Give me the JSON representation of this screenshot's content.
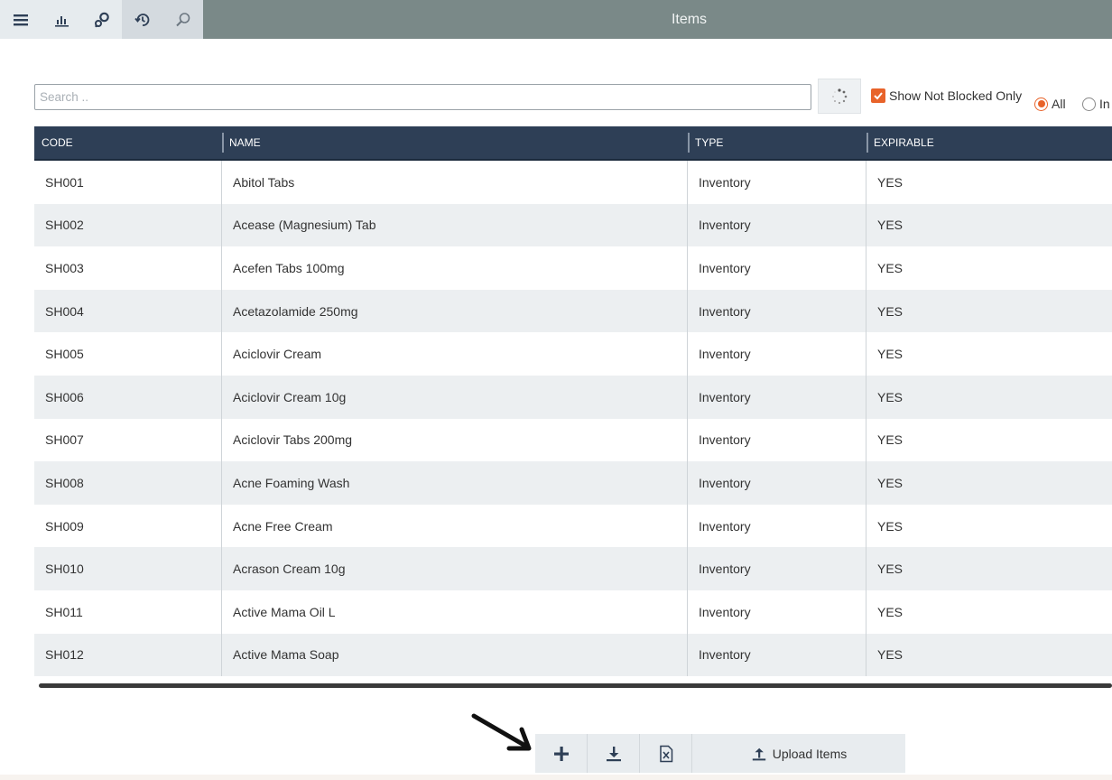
{
  "window": {
    "title": "Items"
  },
  "toolbar": {
    "buttons": [
      {
        "icon": "menu-icon"
      },
      {
        "icon": "chart-icon"
      },
      {
        "icon": "settings-icon"
      },
      {
        "icon": "history-icon"
      },
      {
        "icon": "search-icon"
      }
    ]
  },
  "filters": {
    "search_placeholder": "Search ..",
    "search_value": "",
    "show_not_blocked_label": "Show Not Blocked Only",
    "show_not_blocked_checked": true,
    "radio_all_label": "All",
    "radio_in_label": "In",
    "radio_selected": "All"
  },
  "table": {
    "columns": [
      "CODE",
      "NAME",
      "TYPE",
      "EXPIRABLE"
    ],
    "rows": [
      {
        "code": "SH001",
        "name": "Abitol Tabs",
        "type": "Inventory",
        "expirable": "YES"
      },
      {
        "code": "SH002",
        "name": "Acease (Magnesium) Tab",
        "type": "Inventory",
        "expirable": "YES"
      },
      {
        "code": "SH003",
        "name": "Acefen Tabs 100mg",
        "type": "Inventory",
        "expirable": "YES"
      },
      {
        "code": "SH004",
        "name": "Acetazolamide 250mg",
        "type": "Inventory",
        "expirable": "YES"
      },
      {
        "code": "SH005",
        "name": "Aciclovir Cream",
        "type": "Inventory",
        "expirable": "YES"
      },
      {
        "code": "SH006",
        "name": "Aciclovir Cream 10g",
        "type": "Inventory",
        "expirable": "YES"
      },
      {
        "code": "SH007",
        "name": "Aciclovir Tabs 200mg",
        "type": "Inventory",
        "expirable": "YES"
      },
      {
        "code": "SH008",
        "name": "Acne Foaming Wash",
        "type": "Inventory",
        "expirable": "YES"
      },
      {
        "code": "SH009",
        "name": "Acne Free Cream",
        "type": "Inventory",
        "expirable": "YES"
      },
      {
        "code": "SH010",
        "name": "Acrason Cream 10g",
        "type": "Inventory",
        "expirable": "YES"
      },
      {
        "code": "SH011",
        "name": "Active Mama Oil L",
        "type": "Inventory",
        "expirable": "YES"
      },
      {
        "code": "SH012",
        "name": "Active Mama Soap",
        "type": "Inventory",
        "expirable": "YES"
      }
    ]
  },
  "actions": {
    "add_icon": "plus-icon",
    "download_icon": "download-icon",
    "excel_icon": "excel-icon",
    "upload_label": "Upload Items",
    "upload_icon": "upload-icon"
  },
  "colors": {
    "accent": "#e8632a",
    "header_bg": "#2e3f56",
    "title_bar": "#7a8988"
  }
}
